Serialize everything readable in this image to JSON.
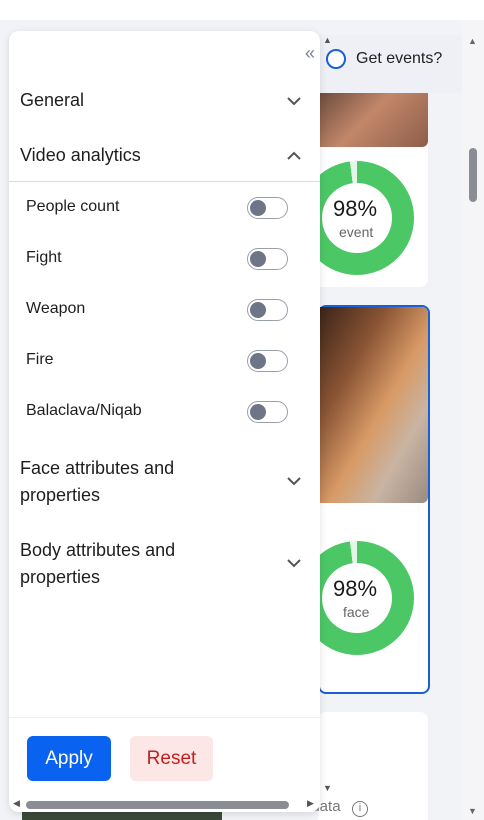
{
  "panel": {
    "collapse_icon": "double-chevron-left-icon",
    "sections": [
      {
        "label": "General",
        "expanded": false
      },
      {
        "label": "Video analytics",
        "expanded": true
      },
      {
        "label": "Face attributes and properties",
        "expanded": false
      },
      {
        "label": "Body attributes and properties",
        "expanded": false
      }
    ],
    "options": [
      {
        "label": "People count",
        "on": false
      },
      {
        "label": "Fight",
        "on": false
      },
      {
        "label": "Weapon",
        "on": false
      },
      {
        "label": "Fire",
        "on": false
      },
      {
        "label": "Balaclava/Niqab",
        "on": false
      }
    ],
    "apply_label": "Apply",
    "reset_label": "Reset"
  },
  "get_events": {
    "label": "Get events?",
    "checked": false
  },
  "cards": [
    {
      "percent": "98%",
      "type": "event"
    },
    {
      "percent": "98%",
      "type": "face",
      "selected": true
    },
    {
      "status": "No data"
    }
  ],
  "colors": {
    "accent": "#0a63f0",
    "reset_bg": "#fde6e6",
    "reset_text": "#c41f1f",
    "ring": "#4cc766",
    "selected_border": "#1a5fd6"
  }
}
